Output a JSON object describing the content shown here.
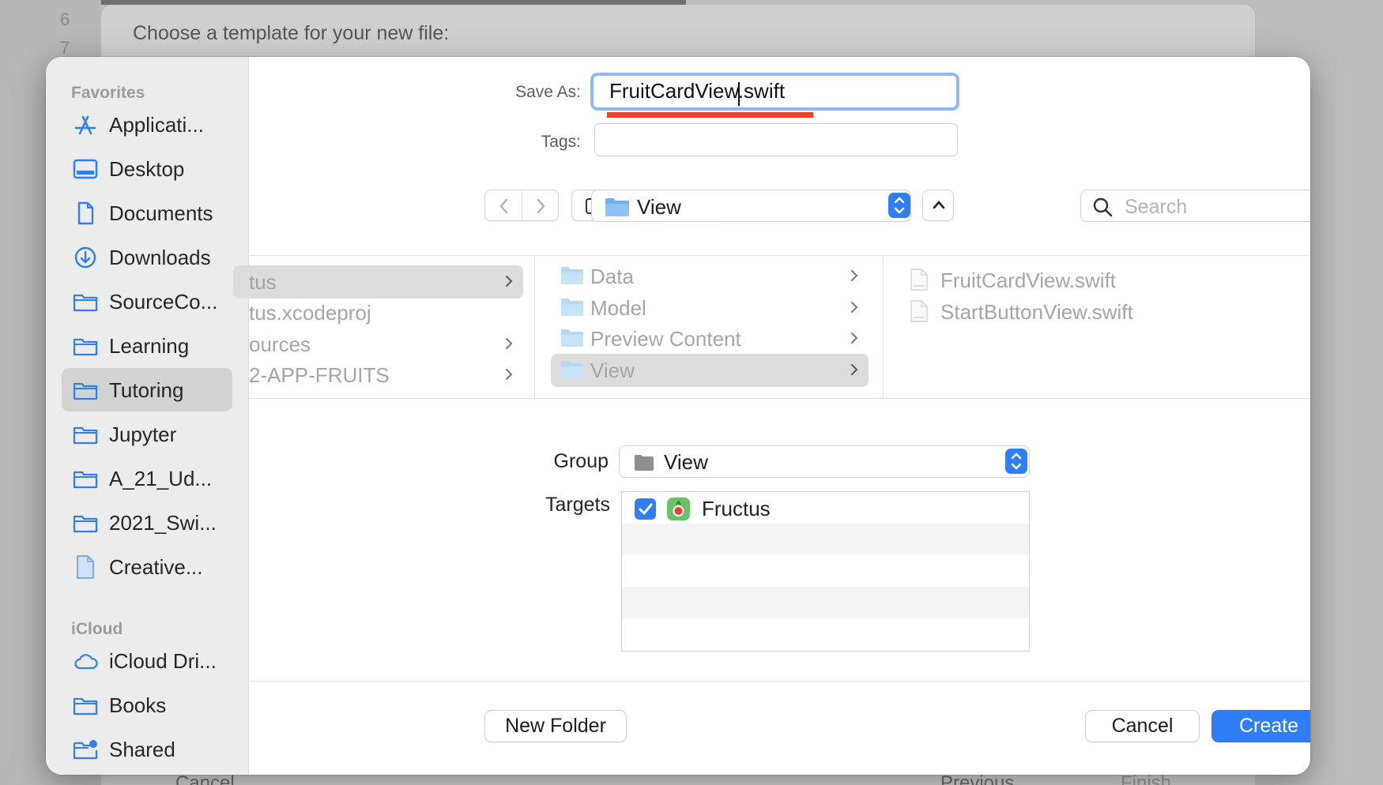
{
  "background": {
    "line_numbers": [
      "6",
      "7"
    ],
    "template_title": "Choose a template for your new file:",
    "footer_cancel": "Cancel",
    "footer_previous": "Previous",
    "footer_finish": "Finish"
  },
  "sidebar": {
    "favorites_label": "Favorites",
    "favorites": [
      {
        "label": "Applicati...",
        "icon": "applications-icon"
      },
      {
        "label": "Desktop",
        "icon": "desktop-icon"
      },
      {
        "label": "Documents",
        "icon": "document-icon"
      },
      {
        "label": "Downloads",
        "icon": "downloads-icon"
      },
      {
        "label": "SourceCo...",
        "icon": "folder-icon"
      },
      {
        "label": "Learning",
        "icon": "folder-icon"
      },
      {
        "label": "Tutoring",
        "icon": "folder-icon",
        "selected": true
      },
      {
        "label": "Jupyter",
        "icon": "folder-icon"
      },
      {
        "label": "A_21_Ud...",
        "icon": "folder-icon"
      },
      {
        "label": "2021_Swi...",
        "icon": "folder-icon"
      },
      {
        "label": "Creative...",
        "icon": "file-icon"
      }
    ],
    "icloud_label": "iCloud",
    "icloud": [
      {
        "label": "iCloud Dri...",
        "icon": "cloud-icon"
      },
      {
        "label": "Books",
        "icon": "folder-icon"
      },
      {
        "label": "Shared",
        "icon": "shared-folder-icon"
      }
    ]
  },
  "form": {
    "save_as_label": "Save As:",
    "save_as_value": "FruitCardView.swift",
    "tags_label": "Tags:",
    "tags_value": ""
  },
  "toolbar": {
    "location": "View",
    "search_placeholder": "Search"
  },
  "browser": {
    "column1": [
      {
        "label": "tus",
        "has_children": true,
        "selected": true
      },
      {
        "label": "tus.xcodeproj",
        "has_children": false
      },
      {
        "label": "ources",
        "has_children": true
      },
      {
        "label": "2-APP-FRUITS",
        "has_children": true
      }
    ],
    "column2": [
      {
        "label": "Data",
        "has_children": true
      },
      {
        "label": "Model",
        "has_children": true
      },
      {
        "label": "Preview Content",
        "has_children": true
      },
      {
        "label": "View",
        "has_children": true,
        "selected": true
      }
    ],
    "column3": [
      {
        "label": "FruitCardView.swift"
      },
      {
        "label": "StartButtonView.swift"
      }
    ]
  },
  "options": {
    "group_label": "Group",
    "group_value": "View",
    "targets_label": "Targets",
    "targets": [
      {
        "name": "Fructus",
        "checked": true
      }
    ]
  },
  "buttons": {
    "new_folder": "New Folder",
    "cancel": "Cancel",
    "create": "Create"
  },
  "colors": {
    "accent": "#2f7ef6",
    "folder": "#6fb0ea",
    "annotation_underline": "#e8412c"
  }
}
